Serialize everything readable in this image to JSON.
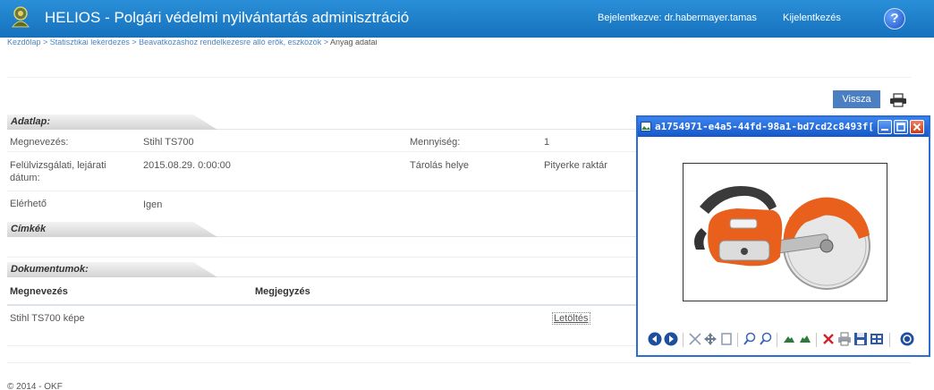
{
  "header": {
    "title": "HELIOS - Polgári védelmi nyilvántartás adminisztráció",
    "login_info": "Bejelentkezve: dr.habermayer.tamas",
    "logout_label": "Kijelentkezés",
    "help_label": "?"
  },
  "breadcrumb": {
    "path": "Kezdőlap > Statisztikai lekérdezés > Beavatkozáshoz rendelkezésre álló erők, eszközök > ",
    "current": "Anyag adatai"
  },
  "back_button": "Vissza",
  "sections": {
    "adatlap": "Adatlap:",
    "cimkek": "Címkék",
    "dokumentumok": "Dokumentumok:"
  },
  "fields": {
    "megnevezes_label": "Megnevezés:",
    "megnevezes_value": "Stihl TS700",
    "mennyiseg_label": "Mennyiség:",
    "mennyiseg_value": "1",
    "datum_label": "Felülvizsgálati, lejárati dátum:",
    "datum_value": "2015.08.29. 0:00:00",
    "tarolas_label": "Tárolás helye",
    "tarolas_value": "Pityerke raktár",
    "elerheto_label": "Elérhető",
    "elerheto_value": "Igen"
  },
  "documents": {
    "columns": [
      "Megnevezés",
      "Megjegyzés"
    ],
    "rows": [
      {
        "name": "Stihl TS700 képe",
        "link": "Letöltés"
      }
    ]
  },
  "footer": "© 2014 - OKF",
  "viewer": {
    "title": "a1754971-e4a5-44fd-98a1-bd7cd2c8493f[..."
  },
  "colors": {
    "header_blue": "#1e7fcb",
    "button_blue": "#4a7fc1",
    "viewer_border": "#2b6fd6"
  }
}
